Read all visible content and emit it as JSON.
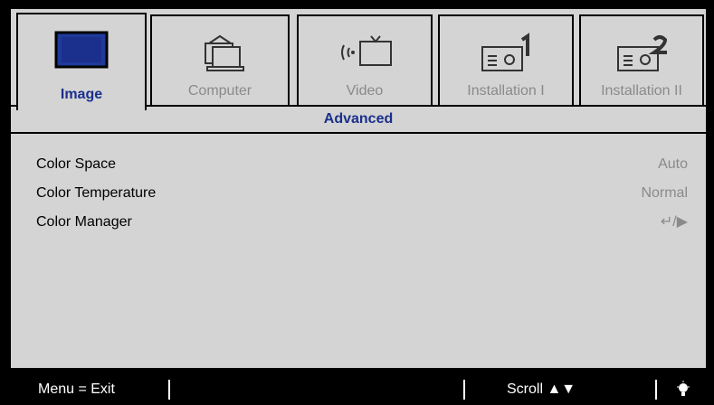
{
  "tabs": [
    {
      "label": "Image",
      "icon": "monitor-icon",
      "active": true
    },
    {
      "label": "Computer",
      "icon": "computer-icon",
      "active": false
    },
    {
      "label": "Video",
      "icon": "video-icon",
      "active": false
    },
    {
      "label": "Installation I",
      "icon": "installation-1-icon",
      "active": false
    },
    {
      "label": "Installation II",
      "icon": "installation-2-icon",
      "active": false
    }
  ],
  "sub_header": "Advanced",
  "settings": [
    {
      "name": "Color Space",
      "value": "Auto"
    },
    {
      "name": "Color Temperature",
      "value": "Normal"
    },
    {
      "name": "Color Manager",
      "value": "↵/▶"
    }
  ],
  "footer": {
    "menu_hint": "Menu = Exit",
    "scroll_hint": "Scroll ▲▼",
    "bulb_icon": "bulb-icon"
  },
  "colors": {
    "accent": "#1b2f8c",
    "panel": "#d4d4d4",
    "inactive_text": "#8a8a8a"
  }
}
